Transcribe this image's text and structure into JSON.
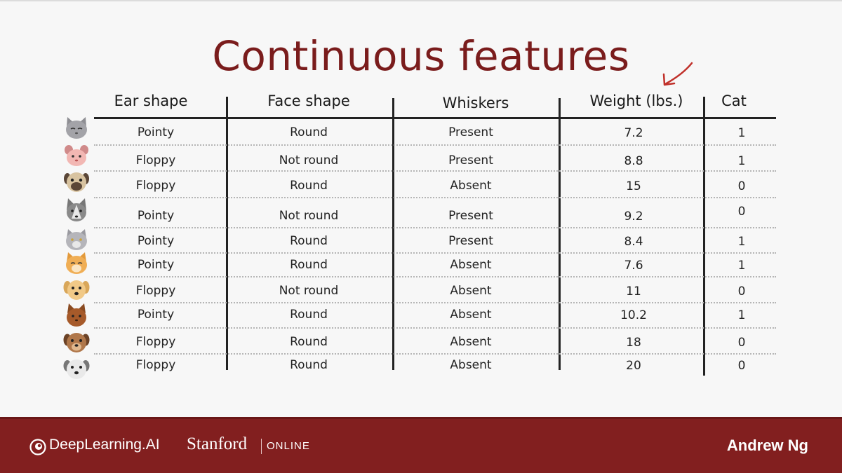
{
  "slide": {
    "title": "Continuous features"
  },
  "table": {
    "headers": [
      "Ear shape",
      "Face shape",
      "Whiskers",
      "Weight (lbs.)",
      "Cat"
    ],
    "rows": [
      {
        "animal": "gray-cat-icon",
        "cells": [
          "Pointy",
          "Round",
          "Present",
          "7.2",
          "1"
        ]
      },
      {
        "animal": "pink-cat-icon",
        "cells": [
          "Floppy",
          "Not round",
          "Present",
          "8.8",
          "1"
        ]
      },
      {
        "animal": "pug-dog-icon",
        "cells": [
          "Floppy",
          "Round",
          "Absent",
          "15",
          "0"
        ]
      },
      {
        "animal": "husky-dog-icon",
        "cells": [
          "Pointy",
          "Not round",
          "Present",
          "9.2",
          "0"
        ]
      },
      {
        "animal": "gray-cat-icon-2",
        "cells": [
          "Pointy",
          "Round",
          "Present",
          "8.4",
          "1"
        ]
      },
      {
        "animal": "orange-cat-icon",
        "cells": [
          "Pointy",
          "Round",
          "Absent",
          "7.6",
          "1"
        ]
      },
      {
        "animal": "golden-dog-icon",
        "cells": [
          "Floppy",
          "Not round",
          "Absent",
          "11",
          "0"
        ]
      },
      {
        "animal": "brown-cat-icon",
        "cells": [
          "Pointy",
          "Round",
          "Absent",
          "10.2",
          "1"
        ]
      },
      {
        "animal": "brown-dog-icon",
        "cells": [
          "Floppy",
          "Round",
          "Absent",
          "18",
          "0"
        ]
      },
      {
        "animal": "white-dog-icon",
        "cells": [
          "Floppy",
          "Round",
          "Absent",
          "20",
          "0"
        ]
      }
    ]
  },
  "footer": {
    "brand": "DeepLearning.AI",
    "university": "Stanford",
    "online": "ONLINE",
    "author": "Andrew Ng"
  },
  "colors": {
    "title": "#7a1c1c",
    "footer_bg": "#821f1f",
    "arrow": "#c0302a"
  }
}
